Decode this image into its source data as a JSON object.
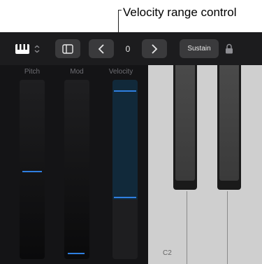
{
  "callout": {
    "text": "Velocity range control"
  },
  "toolbar": {
    "octave_value": "0",
    "sustain_label": "Sustain",
    "icons": [
      "keyboard-icon",
      "sidebar-icon",
      "chevron-left-icon",
      "chevron-right-icon",
      "lock-icon"
    ]
  },
  "sliders": [
    {
      "label": "Pitch",
      "level": 0.49
    },
    {
      "label": "Mod",
      "level": 0.02
    }
  ],
  "velocity": {
    "label": "Velocity",
    "range_high": 0.95,
    "range_low": 0.34
  },
  "keyboard": {
    "start_key_label": "C2"
  },
  "colors": {
    "accent_blue": "#2f7fe0",
    "range_fill": "#11293a"
  }
}
